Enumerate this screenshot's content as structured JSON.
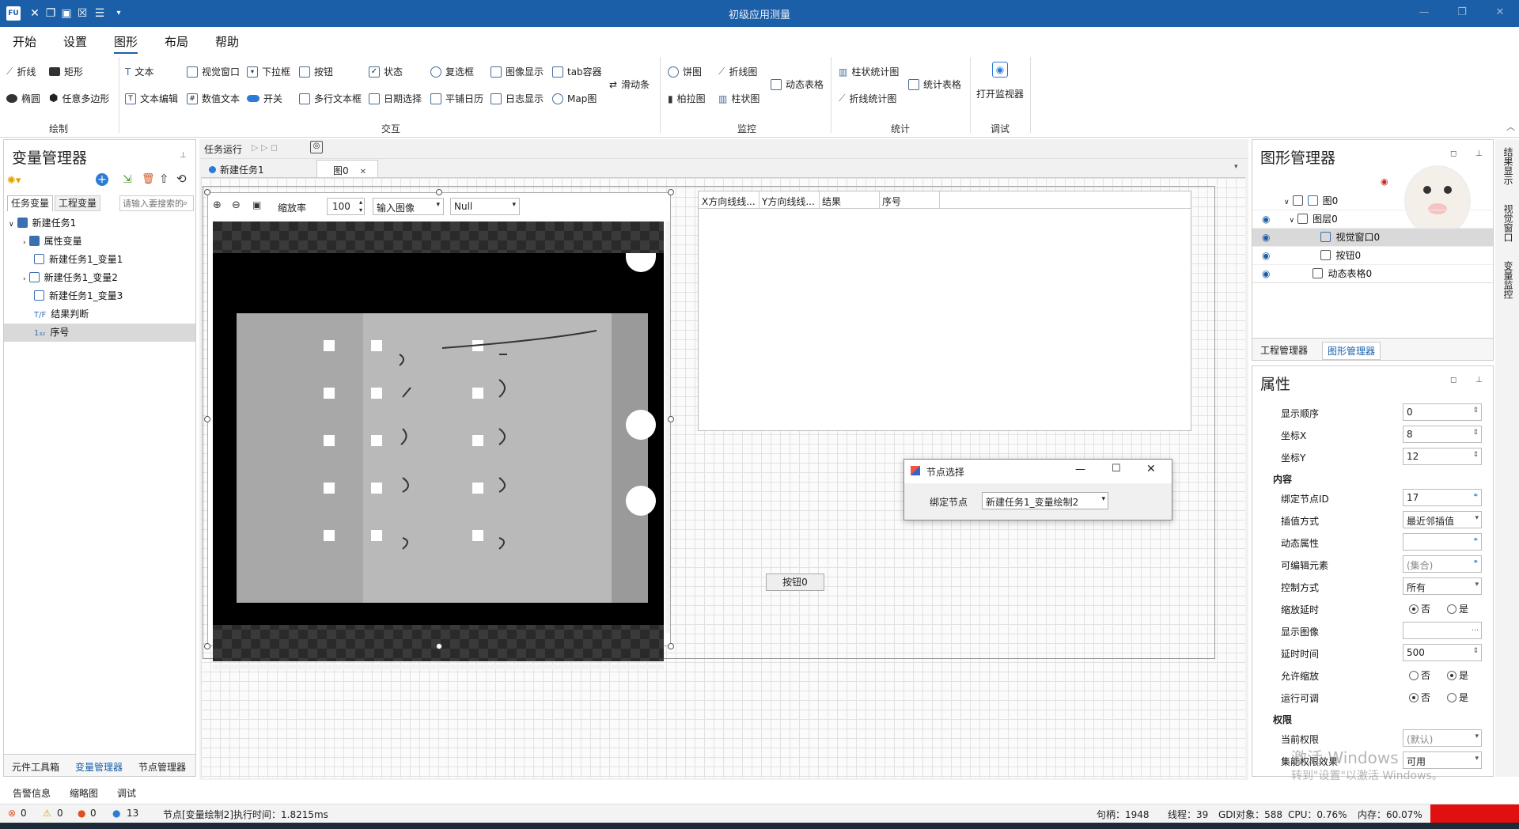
{
  "titlebar": {
    "title": "初级应用测量",
    "logo": "FU"
  },
  "menu": {
    "items": [
      "开始",
      "设置",
      "图形",
      "布局",
      "帮助"
    ]
  },
  "ribbon": {
    "draw": {
      "label": "绘制",
      "items": [
        "折线",
        "矩形",
        "椭圆",
        "任意多边形"
      ]
    },
    "interact": {
      "label": "交互",
      "row1": [
        "文本",
        "视觉窗口",
        "下拉框",
        "按钮",
        "状态",
        "复选框",
        "图像显示",
        "tab容器"
      ],
      "row2": [
        "文本编辑",
        "数值文本",
        "开关",
        "多行文本框",
        "日期选择",
        "平铺日历",
        "日志显示",
        "Map图"
      ],
      "slider": "滑动条"
    },
    "monitor": {
      "label": "监控",
      "items": [
        "饼图",
        "折线图",
        "柏拉图",
        "柱状图",
        "动态表格"
      ]
    },
    "stats": {
      "label": "统计",
      "items": [
        "柱状统计图",
        "统计表格",
        "折线统计图"
      ]
    },
    "debug": {
      "label": "调试",
      "items": [
        "打开监视器"
      ]
    }
  },
  "var_manager": {
    "title": "变量管理器",
    "tabs": [
      "任务变量",
      "工程变量"
    ],
    "search_placeholder": "请输入要搜索的",
    "tree": [
      {
        "label": "新建任务1",
        "level": 0
      },
      {
        "label": "属性变量",
        "level": 1
      },
      {
        "label": "新建任务1_变量1",
        "level": 1
      },
      {
        "label": "新建任务1_变量2",
        "level": 1
      },
      {
        "label": "新建任务1_变量3",
        "level": 1
      },
      {
        "label": "结果判断",
        "level": 1
      },
      {
        "label": "序号",
        "level": 1
      }
    ],
    "bottom_tabs": [
      "元件工具箱",
      "变量管理器",
      "节点管理器"
    ]
  },
  "bottom_panel_tabs": [
    "告警信息",
    "缩略图",
    "调试"
  ],
  "doc": {
    "run_label": "任务运行",
    "tabs": [
      "新建任务1",
      "图0"
    ],
    "zoom_label": "缩放率",
    "zoom_value": "100",
    "input_select": "输入图像",
    "null_select": "Null",
    "table_headers": [
      "X方向线线...",
      "Y方向线线...",
      "结果",
      "序号"
    ],
    "button_label": "按钮0"
  },
  "dialog": {
    "title": "节点选择",
    "label": "绑定节点",
    "value": "新建任务1_变量绘制2"
  },
  "shape_manager": {
    "title": "图形管理器",
    "tree": [
      "图0",
      "图层0",
      "视觉窗口0",
      "按钮0",
      "动态表格0"
    ],
    "tabs": [
      "工程管理器",
      "图形管理器"
    ]
  },
  "properties": {
    "title": "属性",
    "rows": [
      {
        "label": "显示顺序",
        "value": "0",
        "kind": "spin"
      },
      {
        "label": "坐标X",
        "value": "8",
        "kind": "spin"
      },
      {
        "label": "坐标Y",
        "value": "12",
        "kind": "spin"
      }
    ],
    "section_content": "内容",
    "content_rows": [
      {
        "label": "绑定节点ID",
        "value": "17",
        "kind": "link"
      },
      {
        "label": "插值方式",
        "value": "最近邻插值",
        "kind": "select"
      },
      {
        "label": "动态属性",
        "value": "",
        "kind": "link"
      },
      {
        "label": "可编辑元素",
        "value": "(集合)",
        "kind": "link"
      },
      {
        "label": "控制方式",
        "value": "所有",
        "kind": "select"
      },
      {
        "label": "缩放延时",
        "value": "否",
        "kind": "radio"
      },
      {
        "label": "显示图像",
        "value": "",
        "kind": "dots"
      },
      {
        "label": "延时时间",
        "value": "500",
        "kind": "spin"
      },
      {
        "label": "允许缩放",
        "value": "是",
        "kind": "radio"
      },
      {
        "label": "运行可调",
        "value": "否",
        "kind": "radio"
      }
    ],
    "section_perm": "权限",
    "perm_rows": [
      {
        "label": "当前权限",
        "value": "(默认)",
        "kind": "select"
      },
      {
        "label": "集能权限效果",
        "value": "可用",
        "kind": "select"
      }
    ],
    "radio_no": "否",
    "radio_yes": "是"
  },
  "right_sidebar": [
    "结果显示",
    "视觉窗口",
    "变量监控"
  ],
  "watermark": {
    "line1": "激活 Windows",
    "line2": "转到\"设置\"以激活 Windows。"
  },
  "status": {
    "err": "0",
    "warn": "0",
    "info1": "0",
    "info2": "13",
    "message": "节点[变量绘制2]执行时间：1.8215ms",
    "handles": "句柄：1948",
    "threads": "线程：39",
    "gdi": "GDI对象：588",
    "cpu": "CPU：0.76%",
    "mem": "内存：60.07%"
  },
  "colors": {
    "accent": "#1b5fa8",
    "selected": "#d9d9d9"
  }
}
